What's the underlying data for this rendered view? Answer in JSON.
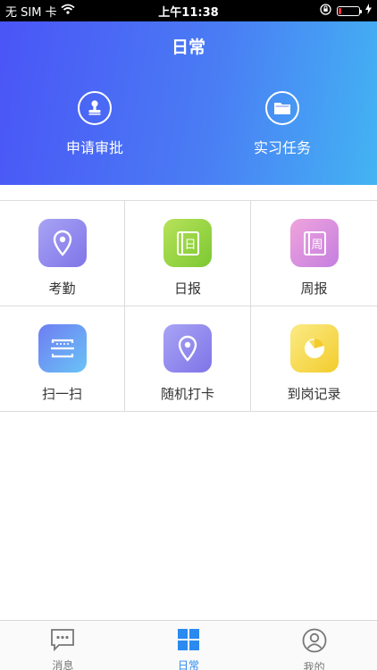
{
  "status_bar": {
    "carrier": "无 SIM 卡",
    "time": "上午11:38",
    "battery_level": 0.12,
    "battery_color": "#e8343f"
  },
  "header": {
    "title": "日常",
    "actions": [
      {
        "label": "申请审批",
        "icon": "stamp-icon"
      },
      {
        "label": "实习任务",
        "icon": "folder-icon"
      }
    ]
  },
  "grid": {
    "items": [
      {
        "label": "考勤",
        "icon": "location-pin-icon",
        "color": "#8b82ec"
      },
      {
        "label": "日报",
        "icon": "daily-report-icon",
        "glyph": "日",
        "color": "#9bd444"
      },
      {
        "label": "周报",
        "icon": "weekly-report-icon",
        "glyph": "周",
        "color": "#d98fe0"
      },
      {
        "label": "扫一扫",
        "icon": "scan-icon",
        "color": "#6a9ef4"
      },
      {
        "label": "随机打卡",
        "icon": "location-pin-icon",
        "color": "#8b82ec"
      },
      {
        "label": "到岗记录",
        "icon": "pie-chart-icon",
        "color": "#f5d43a"
      }
    ]
  },
  "tabbar": {
    "active_color": "#2a8af0",
    "tabs": [
      {
        "label": "消息",
        "icon": "message-icon",
        "active": false
      },
      {
        "label": "日常",
        "icon": "grid-icon",
        "active": true
      },
      {
        "label": "我的",
        "icon": "profile-icon",
        "active": false
      }
    ]
  }
}
